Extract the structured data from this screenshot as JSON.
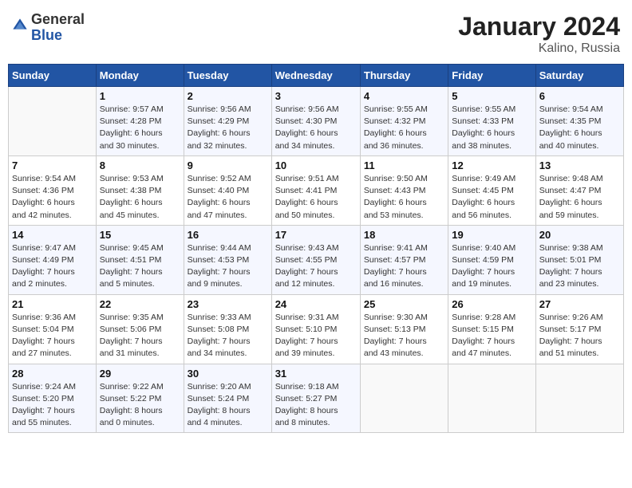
{
  "header": {
    "logo_general": "General",
    "logo_blue": "Blue",
    "month": "January 2024",
    "location": "Kalino, Russia"
  },
  "weekdays": [
    "Sunday",
    "Monday",
    "Tuesday",
    "Wednesday",
    "Thursday",
    "Friday",
    "Saturday"
  ],
  "weeks": [
    [
      {
        "day": "",
        "info": ""
      },
      {
        "day": "1",
        "info": "Sunrise: 9:57 AM\nSunset: 4:28 PM\nDaylight: 6 hours\nand 30 minutes."
      },
      {
        "day": "2",
        "info": "Sunrise: 9:56 AM\nSunset: 4:29 PM\nDaylight: 6 hours\nand 32 minutes."
      },
      {
        "day": "3",
        "info": "Sunrise: 9:56 AM\nSunset: 4:30 PM\nDaylight: 6 hours\nand 34 minutes."
      },
      {
        "day": "4",
        "info": "Sunrise: 9:55 AM\nSunset: 4:32 PM\nDaylight: 6 hours\nand 36 minutes."
      },
      {
        "day": "5",
        "info": "Sunrise: 9:55 AM\nSunset: 4:33 PM\nDaylight: 6 hours\nand 38 minutes."
      },
      {
        "day": "6",
        "info": "Sunrise: 9:54 AM\nSunset: 4:35 PM\nDaylight: 6 hours\nand 40 minutes."
      }
    ],
    [
      {
        "day": "7",
        "info": "Sunrise: 9:54 AM\nSunset: 4:36 PM\nDaylight: 6 hours\nand 42 minutes."
      },
      {
        "day": "8",
        "info": "Sunrise: 9:53 AM\nSunset: 4:38 PM\nDaylight: 6 hours\nand 45 minutes."
      },
      {
        "day": "9",
        "info": "Sunrise: 9:52 AM\nSunset: 4:40 PM\nDaylight: 6 hours\nand 47 minutes."
      },
      {
        "day": "10",
        "info": "Sunrise: 9:51 AM\nSunset: 4:41 PM\nDaylight: 6 hours\nand 50 minutes."
      },
      {
        "day": "11",
        "info": "Sunrise: 9:50 AM\nSunset: 4:43 PM\nDaylight: 6 hours\nand 53 minutes."
      },
      {
        "day": "12",
        "info": "Sunrise: 9:49 AM\nSunset: 4:45 PM\nDaylight: 6 hours\nand 56 minutes."
      },
      {
        "day": "13",
        "info": "Sunrise: 9:48 AM\nSunset: 4:47 PM\nDaylight: 6 hours\nand 59 minutes."
      }
    ],
    [
      {
        "day": "14",
        "info": "Sunrise: 9:47 AM\nSunset: 4:49 PM\nDaylight: 7 hours\nand 2 minutes."
      },
      {
        "day": "15",
        "info": "Sunrise: 9:45 AM\nSunset: 4:51 PM\nDaylight: 7 hours\nand 5 minutes."
      },
      {
        "day": "16",
        "info": "Sunrise: 9:44 AM\nSunset: 4:53 PM\nDaylight: 7 hours\nand 9 minutes."
      },
      {
        "day": "17",
        "info": "Sunrise: 9:43 AM\nSunset: 4:55 PM\nDaylight: 7 hours\nand 12 minutes."
      },
      {
        "day": "18",
        "info": "Sunrise: 9:41 AM\nSunset: 4:57 PM\nDaylight: 7 hours\nand 16 minutes."
      },
      {
        "day": "19",
        "info": "Sunrise: 9:40 AM\nSunset: 4:59 PM\nDaylight: 7 hours\nand 19 minutes."
      },
      {
        "day": "20",
        "info": "Sunrise: 9:38 AM\nSunset: 5:01 PM\nDaylight: 7 hours\nand 23 minutes."
      }
    ],
    [
      {
        "day": "21",
        "info": "Sunrise: 9:36 AM\nSunset: 5:04 PM\nDaylight: 7 hours\nand 27 minutes."
      },
      {
        "day": "22",
        "info": "Sunrise: 9:35 AM\nSunset: 5:06 PM\nDaylight: 7 hours\nand 31 minutes."
      },
      {
        "day": "23",
        "info": "Sunrise: 9:33 AM\nSunset: 5:08 PM\nDaylight: 7 hours\nand 34 minutes."
      },
      {
        "day": "24",
        "info": "Sunrise: 9:31 AM\nSunset: 5:10 PM\nDaylight: 7 hours\nand 39 minutes."
      },
      {
        "day": "25",
        "info": "Sunrise: 9:30 AM\nSunset: 5:13 PM\nDaylight: 7 hours\nand 43 minutes."
      },
      {
        "day": "26",
        "info": "Sunrise: 9:28 AM\nSunset: 5:15 PM\nDaylight: 7 hours\nand 47 minutes."
      },
      {
        "day": "27",
        "info": "Sunrise: 9:26 AM\nSunset: 5:17 PM\nDaylight: 7 hours\nand 51 minutes."
      }
    ],
    [
      {
        "day": "28",
        "info": "Sunrise: 9:24 AM\nSunset: 5:20 PM\nDaylight: 7 hours\nand 55 minutes."
      },
      {
        "day": "29",
        "info": "Sunrise: 9:22 AM\nSunset: 5:22 PM\nDaylight: 8 hours\nand 0 minutes."
      },
      {
        "day": "30",
        "info": "Sunrise: 9:20 AM\nSunset: 5:24 PM\nDaylight: 8 hours\nand 4 minutes."
      },
      {
        "day": "31",
        "info": "Sunrise: 9:18 AM\nSunset: 5:27 PM\nDaylight: 8 hours\nand 8 minutes."
      },
      {
        "day": "",
        "info": ""
      },
      {
        "day": "",
        "info": ""
      },
      {
        "day": "",
        "info": ""
      }
    ]
  ]
}
